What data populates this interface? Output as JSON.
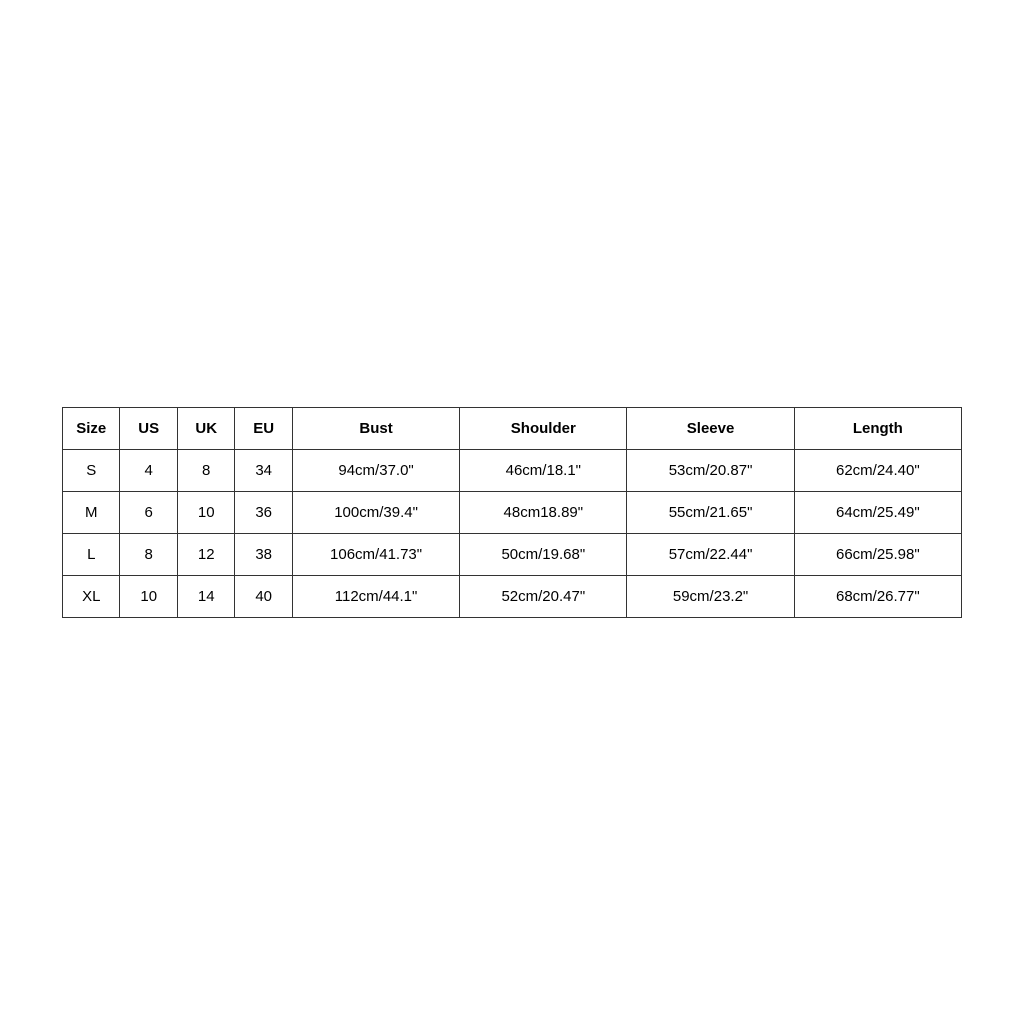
{
  "table": {
    "headers": [
      "Size",
      "US",
      "UK",
      "EU",
      "Bust",
      "Shoulder",
      "Sleeve",
      "Length"
    ],
    "rows": [
      {
        "size": "S",
        "us": "4",
        "uk": "8",
        "eu": "34",
        "bust": "94cm/37.0\"",
        "shoulder": "46cm/18.1\"",
        "sleeve": "53cm/20.87\"",
        "length": "62cm/24.40\""
      },
      {
        "size": "M",
        "us": "6",
        "uk": "10",
        "eu": "36",
        "bust": "100cm/39.4\"",
        "shoulder": "48cm18.89\"",
        "sleeve": "55cm/21.65\"",
        "length": "64cm/25.49\""
      },
      {
        "size": "L",
        "us": "8",
        "uk": "12",
        "eu": "38",
        "bust": "106cm/41.73\"",
        "shoulder": "50cm/19.68\"",
        "sleeve": "57cm/22.44\"",
        "length": "66cm/25.98\""
      },
      {
        "size": "XL",
        "us": "10",
        "uk": "14",
        "eu": "40",
        "bust": "112cm/44.1\"",
        "shoulder": "52cm/20.47\"",
        "sleeve": "59cm/23.2\"",
        "length": "68cm/26.77\""
      }
    ]
  }
}
